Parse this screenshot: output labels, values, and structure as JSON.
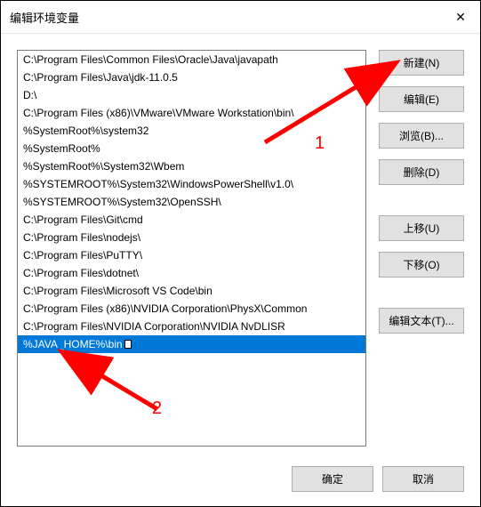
{
  "window": {
    "title": "编辑环境变量"
  },
  "list": {
    "items": [
      "C:\\Program Files\\Common Files\\Oracle\\Java\\javapath",
      "C:\\Program Files\\Java\\jdk-11.0.5",
      "D:\\",
      "C:\\Program Files (x86)\\VMware\\VMware Workstation\\bin\\",
      "%SystemRoot%\\system32",
      "%SystemRoot%",
      "%SystemRoot%\\System32\\Wbem",
      "%SYSTEMROOT%\\System32\\WindowsPowerShell\\v1.0\\",
      "%SYSTEMROOT%\\System32\\OpenSSH\\",
      "C:\\Program Files\\Git\\cmd",
      "C:\\Program Files\\nodejs\\",
      "C:\\Program Files\\PuTTY\\",
      "C:\\Program Files\\dotnet\\",
      "C:\\Program Files\\Microsoft VS Code\\bin",
      "C:\\Program Files (x86)\\NVIDIA Corporation\\PhysX\\Common",
      "C:\\Program Files\\NVIDIA Corporation\\NVIDIA NvDLISR",
      "%JAVA_HOME%\\bin"
    ],
    "selected_index": 16
  },
  "buttons": {
    "new": "新建(N)",
    "edit": "编辑(E)",
    "browse": "浏览(B)...",
    "delete": "删除(D)",
    "move_up": "上移(U)",
    "move_down": "下移(O)",
    "edit_text": "编辑文本(T)...",
    "ok": "确定",
    "cancel": "取消"
  },
  "annotations": {
    "label1": "1",
    "label2": "2"
  }
}
